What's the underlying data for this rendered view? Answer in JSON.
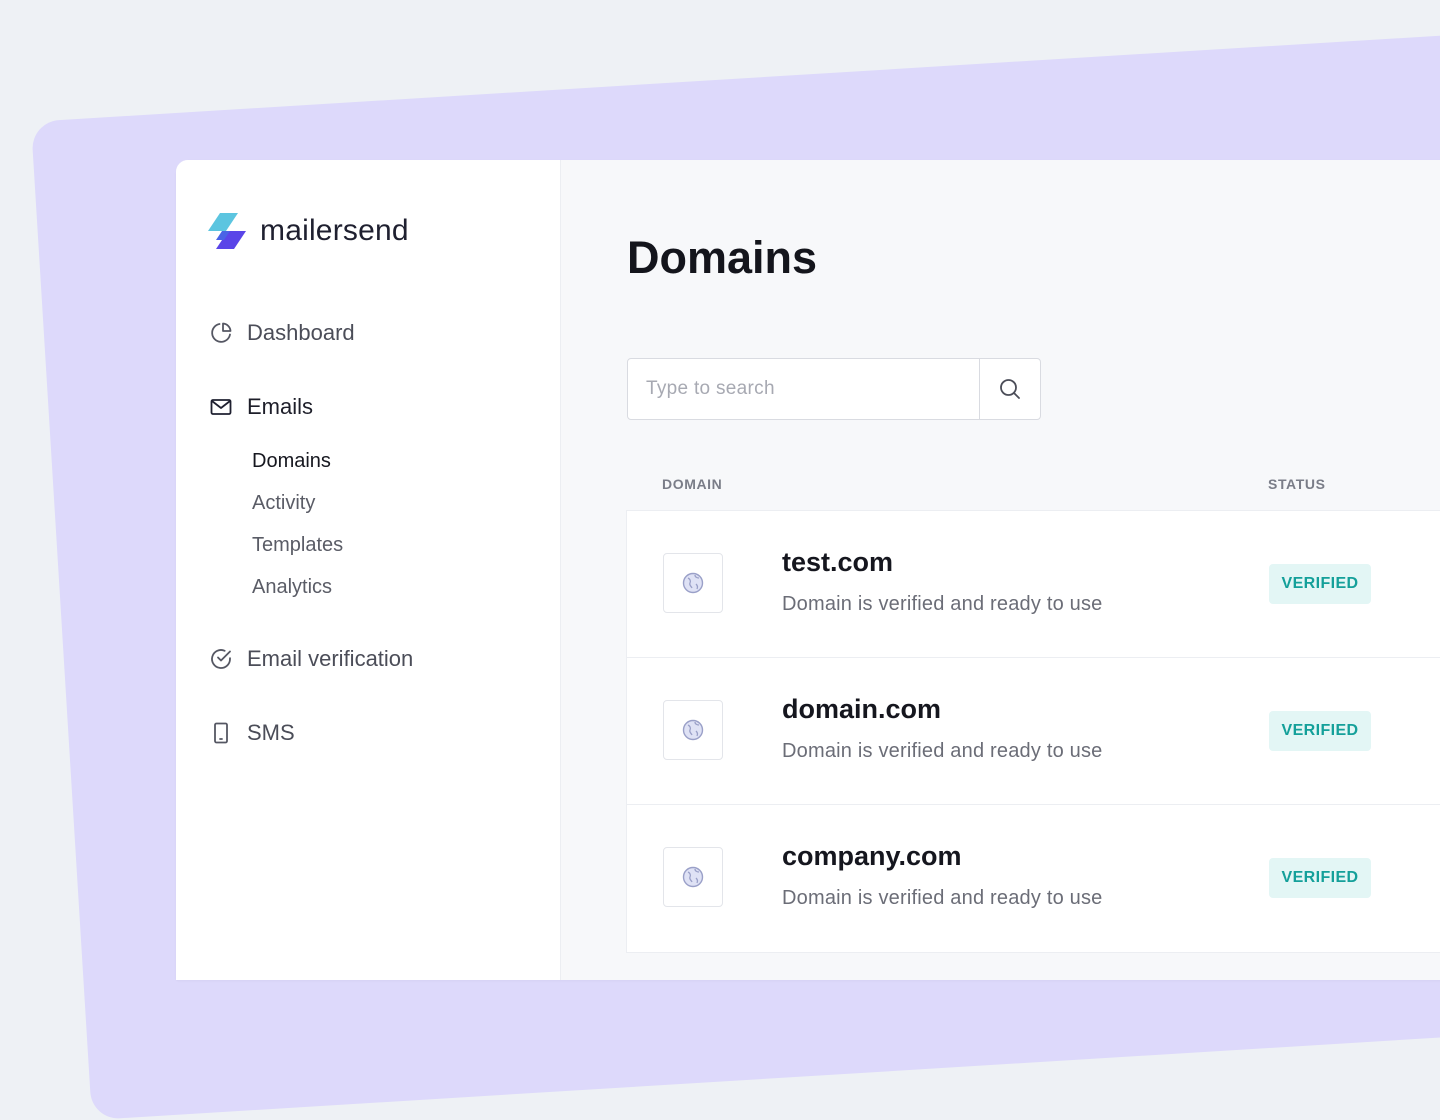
{
  "brand": {
    "name": "mailersend",
    "accent": "#6a4cf5",
    "accent2": "#3fb8d9"
  },
  "sidebar": {
    "items": [
      {
        "label": "Dashboard",
        "icon": "pie-chart-icon"
      },
      {
        "label": "Emails",
        "icon": "mail-icon",
        "active": true,
        "subitems": [
          {
            "label": "Domains",
            "active": true
          },
          {
            "label": "Activity"
          },
          {
            "label": "Templates"
          },
          {
            "label": "Analytics"
          }
        ]
      },
      {
        "label": "Email verification",
        "icon": "check-circle-icon"
      },
      {
        "label": "SMS",
        "icon": "phone-icon"
      }
    ]
  },
  "main": {
    "title": "Domains",
    "search": {
      "placeholder": "Type to search",
      "value": ""
    },
    "table": {
      "headers": {
        "domain": "DOMAIN",
        "status": "STATUS"
      },
      "rows": [
        {
          "name": "test.com",
          "description": "Domain is verified and ready to use",
          "status": "VERIFIED"
        },
        {
          "name": "domain.com",
          "description": "Domain is verified and ready to use",
          "status": "VERIFIED"
        },
        {
          "name": "company.com",
          "description": "Domain is verified and ready to use",
          "status": "VERIFIED"
        }
      ]
    }
  },
  "colors": {
    "verified_bg": "#e3f6f5",
    "verified_text": "#14a09a",
    "decor": "#ddd9fb"
  }
}
